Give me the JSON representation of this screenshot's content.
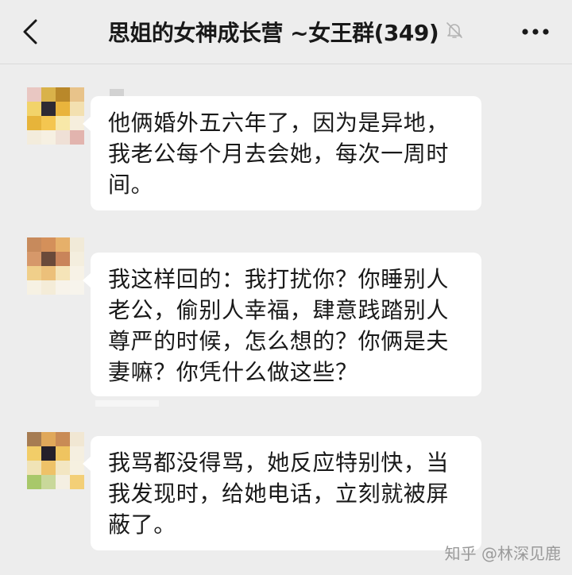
{
  "header": {
    "title": "思姐的女神成长营 ~女王群(349)",
    "back_icon": "chevron-left-icon",
    "mute_icon": "bell-slash-icon",
    "more_icon": "more-dots-icon"
  },
  "messages": [
    {
      "text": "他俩婚外五六年了，因为是异地，我老公每个月去会她，每次一周时间。",
      "avatar": "pixelated-avatar"
    },
    {
      "text": "我这样回的：我打扰你？你睡别人老公，偷别人幸福，肆意践踏别人尊严的时候，怎么想的？你俩是夫妻嘛？你凭什么做这些？",
      "avatar": "pixelated-avatar"
    },
    {
      "text": "我骂都没得骂，她反应特别快，当我发现时，给她电话，立刻就被屏蔽了。",
      "avatar": "pixelated-avatar"
    }
  ],
  "watermark": "知乎 @林深见鹿",
  "colors": {
    "background": "#ededed",
    "bubble": "#ffffff",
    "text": "#191919",
    "watermark": "#9a9a9a"
  }
}
